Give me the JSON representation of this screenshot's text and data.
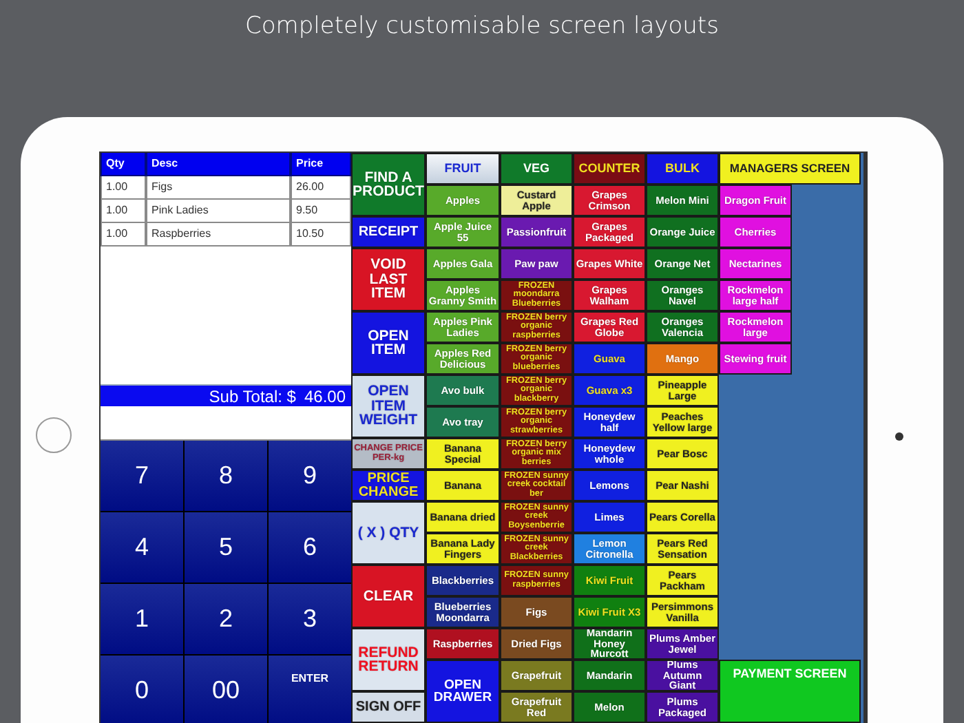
{
  "headline": "Completely customisable screen layouts",
  "order": {
    "columns": [
      "Qty",
      "Desc",
      "Price"
    ],
    "rows": [
      [
        "1.00",
        "Figs",
        "26.00"
      ],
      [
        "1.00",
        "Pink Ladies",
        "9.50"
      ],
      [
        "1.00",
        "Raspberries",
        "10.50"
      ]
    ],
    "subtotal_label": "Sub Total: $",
    "subtotal": "46.00"
  },
  "keypad": [
    {
      "label": "7",
      "kind": "digit"
    },
    {
      "label": "8",
      "kind": "digit"
    },
    {
      "label": "9",
      "kind": "digit"
    },
    {
      "label": "4",
      "kind": "digit"
    },
    {
      "label": "5",
      "kind": "digit"
    },
    {
      "label": "6",
      "kind": "digit"
    },
    {
      "label": "1",
      "kind": "digit"
    },
    {
      "label": "2",
      "kind": "digit"
    },
    {
      "label": "3",
      "kind": "digit"
    },
    {
      "label": "0",
      "kind": "digit"
    },
    {
      "label": "00",
      "kind": "digit"
    },
    {
      "label": "ENTER",
      "kind": "enter"
    }
  ],
  "functions": [
    {
      "label": "FIND A PRODUCT",
      "color": "#107a2a",
      "kind": "white"
    },
    {
      "label": "RECEIPT",
      "color": "#1414e0",
      "kind": "white"
    },
    {
      "label": "VOID LAST ITEM",
      "color": "#d81424",
      "kind": "white"
    },
    {
      "label": "OPEN ITEM",
      "color": "#1414e0",
      "kind": "white"
    },
    {
      "label": "OPEN ITEM WEIGHT",
      "color": "#d4e0ec",
      "kind": "blue"
    },
    {
      "label": "CHANGE PRICE PER-kg",
      "color": "#b4bcc6",
      "kind": "maroon"
    },
    {
      "label": "PRICE CHANGE",
      "color": "#1414e0",
      "kind": "yellow"
    },
    {
      "label": "( X ) QTY",
      "color": "#d8e2ee",
      "kind": "blue"
    },
    {
      "label": "CLEAR",
      "color": "#d81424",
      "kind": "white"
    },
    {
      "label": "REFUND RETURN",
      "color": "#dde6f0",
      "kind": "red"
    },
    {
      "label": "SIGN OFF",
      "color": "#d4dde8",
      "kind": "dark"
    }
  ],
  "tabs": [
    {
      "label": "FRUIT",
      "selected": true,
      "kind": "blue"
    },
    {
      "label": "VEG",
      "selected": false,
      "color": "#107a2a",
      "kind": "white"
    },
    {
      "label": "COUNTER",
      "selected": false,
      "color": "#7a0c14",
      "kind": "yellow"
    },
    {
      "label": "BULK",
      "selected": false,
      "color": "#1414e0",
      "kind": "yellow"
    }
  ],
  "managers_tab": {
    "label": "MANAGERS SCREEN"
  },
  "columns": [
    {
      "items": [
        {
          "label": "Apples",
          "color": "#58aa2a",
          "kind": "white"
        },
        {
          "label": "Apple Juice 55",
          "color": "#58aa2a",
          "kind": "white"
        },
        {
          "label": "Apples Gala",
          "color": "#58aa2a",
          "kind": "white"
        },
        {
          "label": "Apples Granny Smith",
          "color": "#58aa2a",
          "kind": "white"
        },
        {
          "label": "Apples Pink Ladies",
          "color": "#58aa2a",
          "kind": "white"
        },
        {
          "label": "Apples Red Delicious",
          "color": "#58aa2a",
          "kind": "white"
        },
        {
          "label": "Avo bulk",
          "color": "#1e7a50",
          "kind": "white"
        },
        {
          "label": "Avo tray",
          "color": "#1e7a50",
          "kind": "white"
        },
        {
          "label": "Banana Special",
          "color": "#f0f020",
          "kind": "dark"
        },
        {
          "label": "Banana",
          "color": "#f0f020",
          "kind": "dark"
        },
        {
          "label": "Banana dried",
          "color": "#f0f020",
          "kind": "dark"
        },
        {
          "label": "Banana Lady Fingers",
          "color": "#f0f020",
          "kind": "dark"
        },
        {
          "label": "Blackberries",
          "color": "#1a2a8a",
          "kind": "white"
        },
        {
          "label": "Blueberries Moondarra",
          "color": "#1a2a8a",
          "kind": "white"
        },
        {
          "label": "Raspberries",
          "color": "#b01020",
          "kind": "white"
        }
      ]
    },
    {
      "items": [
        {
          "label": "Custard Apple",
          "color": "#eeee99",
          "kind": "dark"
        },
        {
          "label": "Passionfruit",
          "color": "#6a1ab0",
          "kind": "white"
        },
        {
          "label": "Paw paw",
          "color": "#6a1ab0",
          "kind": "white"
        },
        {
          "label": "FROZEN moondarra Blueberries",
          "color": "#7a1010",
          "kind": "yellow"
        },
        {
          "label": "FROZEN berry organic raspberries",
          "color": "#7a1010",
          "kind": "yellow"
        },
        {
          "label": "FROZEN berry organic blueberries",
          "color": "#7a1010",
          "kind": "yellow"
        },
        {
          "label": "FROZEN berry organic blackberry",
          "color": "#7a1010",
          "kind": "yellow"
        },
        {
          "label": "FROZEN berry organic strawberries",
          "color": "#7a1010",
          "kind": "yellow"
        },
        {
          "label": "FROZEN berry organic mix berries",
          "color": "#7a1010",
          "kind": "yellow"
        },
        {
          "label": "FROZEN sunny creek cocktail ber",
          "color": "#7a1010",
          "kind": "yellow"
        },
        {
          "label": "FROZEN sunny creek Boysenberrie",
          "color": "#7a1010",
          "kind": "yellow"
        },
        {
          "label": "FROZEN sunny creek Blackberries",
          "color": "#7a1010",
          "kind": "yellow"
        },
        {
          "label": "FROZEN sunny raspberries",
          "color": "#7a1010",
          "kind": "yellow"
        },
        {
          "label": "Figs",
          "color": "#7a4a20",
          "kind": "white"
        },
        {
          "label": "Dried Figs",
          "color": "#7a4a20",
          "kind": "white"
        },
        {
          "label": "Grapefruit",
          "color": "#7a7a20",
          "kind": "white"
        },
        {
          "label": "Grapefruit Red",
          "color": "#7a7a20",
          "kind": "white"
        }
      ]
    },
    {
      "items": [
        {
          "label": "Grapes Crimson",
          "color": "#d81830",
          "kind": "white"
        },
        {
          "label": "Grapes Packaged",
          "color": "#d81830",
          "kind": "white"
        },
        {
          "label": "Grapes White",
          "color": "#d81830",
          "kind": "white"
        },
        {
          "label": "Grapes Walham",
          "color": "#d81830",
          "kind": "white"
        },
        {
          "label": "Grapes Red Globe",
          "color": "#d81830",
          "kind": "white"
        },
        {
          "label": "Guava",
          "color": "#1020e0",
          "kind": "yellow"
        },
        {
          "label": "Guava x3",
          "color": "#1020e0",
          "kind": "yellow"
        },
        {
          "label": "Honeydew half",
          "color": "#1020e0",
          "kind": "white"
        },
        {
          "label": "Honeydew whole",
          "color": "#1020e0",
          "kind": "white"
        },
        {
          "label": "Lemons",
          "color": "#1020e0",
          "kind": "white"
        },
        {
          "label": "Limes",
          "color": "#1020e0",
          "kind": "white"
        },
        {
          "label": "Lemon Citronella",
          "color": "#2080e0",
          "kind": "white"
        },
        {
          "label": "Kiwi Fruit",
          "color": "#108010",
          "kind": "yellow"
        },
        {
          "label": "Kiwi Fruit X3",
          "color": "#108010",
          "kind": "yellow"
        },
        {
          "label": "Mandarin Honey Murcott",
          "color": "#10701a",
          "kind": "white"
        },
        {
          "label": "Mandarin",
          "color": "#10701a",
          "kind": "white"
        },
        {
          "label": "Melon",
          "color": "#10701a",
          "kind": "white"
        }
      ]
    },
    {
      "items": [
        {
          "label": "Melon Mini",
          "color": "#107020",
          "kind": "white"
        },
        {
          "label": "Orange Juice",
          "color": "#107020",
          "kind": "white"
        },
        {
          "label": "Orange Net",
          "color": "#107020",
          "kind": "white"
        },
        {
          "label": "Oranges Navel",
          "color": "#107020",
          "kind": "white"
        },
        {
          "label": "Oranges Valencia",
          "color": "#107020",
          "kind": "white"
        },
        {
          "label": "Mango",
          "color": "#e07010",
          "kind": "white"
        },
        {
          "label": "Pineapple Large",
          "color": "#f0f020",
          "kind": "dark"
        },
        {
          "label": "Peaches Yellow large",
          "color": "#f0f020",
          "kind": "dark"
        },
        {
          "label": "Pear Bosc",
          "color": "#f0f020",
          "kind": "dark"
        },
        {
          "label": "Pear Nashi",
          "color": "#f0f020",
          "kind": "dark"
        },
        {
          "label": "Pears Corella",
          "color": "#f0f020",
          "kind": "dark"
        },
        {
          "label": "Pears Red Sensation",
          "color": "#f0f020",
          "kind": "dark"
        },
        {
          "label": "Pears Packham",
          "color": "#f0f020",
          "kind": "dark"
        },
        {
          "label": "Persimmons Vanilla",
          "color": "#f0f020",
          "kind": "dark"
        },
        {
          "label": "Plums Amber Jewel",
          "color": "#4a10a0",
          "kind": "white"
        },
        {
          "label": "Plums Autumn Giant",
          "color": "#4a10a0",
          "kind": "white"
        },
        {
          "label": "Plums Packaged",
          "color": "#4a10a0",
          "kind": "white"
        }
      ]
    },
    {
      "items": [
        {
          "label": "Dragon Fruit",
          "color": "#e010e0",
          "kind": "white"
        },
        {
          "label": "Cherries",
          "color": "#e010e0",
          "kind": "white"
        },
        {
          "label": "Nectarines",
          "color": "#e010e0",
          "kind": "white"
        },
        {
          "label": "Rockmelon large half",
          "color": "#e010e0",
          "kind": "white"
        },
        {
          "label": "Rockmelon large",
          "color": "#e010e0",
          "kind": "white"
        },
        {
          "label": "Stewing fruit",
          "color": "#e010e0",
          "kind": "white"
        }
      ]
    }
  ],
  "open_drawer_button": {
    "label": "OPEN DRAWER"
  },
  "payment_button": {
    "label": "PAYMENT SCREEN"
  }
}
